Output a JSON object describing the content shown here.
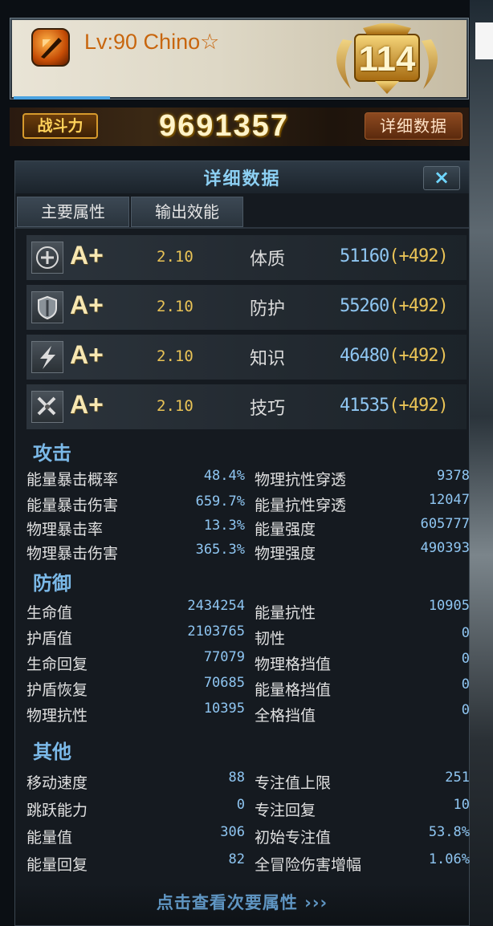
{
  "header": {
    "player_name": "Lv:90 Chino☆",
    "rank_number": "114"
  },
  "power": {
    "label": "战斗力",
    "value": "9691357",
    "detail_button": "详细数据"
  },
  "panel": {
    "title": "详细数据",
    "close_label": "×",
    "tabs": [
      "主要属性",
      "输出效能"
    ],
    "primary_stats": [
      {
        "icon": "cross-circle-icon",
        "grade": "A+",
        "coef": "2.10",
        "name": "体质",
        "value": "51160",
        "bonus": "(+492)"
      },
      {
        "icon": "shield-icon",
        "grade": "A+",
        "coef": "2.10",
        "name": "防护",
        "value": "55260",
        "bonus": "(+492)"
      },
      {
        "icon": "lightning-icon",
        "grade": "A+",
        "coef": "2.10",
        "name": "知识",
        "value": "46480",
        "bonus": "(+492)"
      },
      {
        "icon": "sword-icon",
        "grade": "A+",
        "coef": "2.10",
        "name": "技巧",
        "value": "41535",
        "bonus": "(+492)"
      }
    ],
    "sections": [
      {
        "title": "攻击",
        "rows": [
          {
            "l1": "能量暴击概率",
            "v1": "48.4%",
            "l2": "物理抗性穿透",
            "v2": "9378"
          },
          {
            "l1": "能量暴击伤害",
            "v1": "659.7%",
            "l2": "能量抗性穿透",
            "v2": "12047"
          },
          {
            "l1": "物理暴击率",
            "v1": "13.3%",
            "l2": "能量强度",
            "v2": "605777"
          },
          {
            "l1": "物理暴击伤害",
            "v1": "365.3%",
            "l2": "物理强度",
            "v2": "490393"
          }
        ]
      },
      {
        "title": "防御",
        "rows": [
          {
            "l1": "生命值",
            "v1": "2434254",
            "l2": "能量抗性",
            "v2": "10905"
          },
          {
            "l1": "护盾值",
            "v1": "2103765",
            "l2": "韧性",
            "v2": "0"
          },
          {
            "l1": "生命回复",
            "v1": "77079",
            "l2": "物理格挡值",
            "v2": "0"
          },
          {
            "l1": "护盾恢复",
            "v1": "70685",
            "l2": "能量格挡值",
            "v2": "0"
          },
          {
            "l1": "物理抗性",
            "v1": "10395",
            "l2": "全格挡值",
            "v2": "0"
          }
        ]
      },
      {
        "title": "其他",
        "rows": [
          {
            "l1": "移动速度",
            "v1": "88",
            "l2": "专注值上限",
            "v2": "251"
          },
          {
            "l1": "跳跃能力",
            "v1": "0",
            "l2": "专注回复",
            "v2": "10"
          },
          {
            "l1": "能量值",
            "v1": "306",
            "l2": "初始专注值",
            "v2": "53.8%"
          },
          {
            "l1": "能量回复",
            "v1": "82",
            "l2": "全冒险伤害增幅",
            "v2": "1.06%"
          }
        ]
      }
    ],
    "footer_link": "点击查看次要属性 ›››"
  }
}
